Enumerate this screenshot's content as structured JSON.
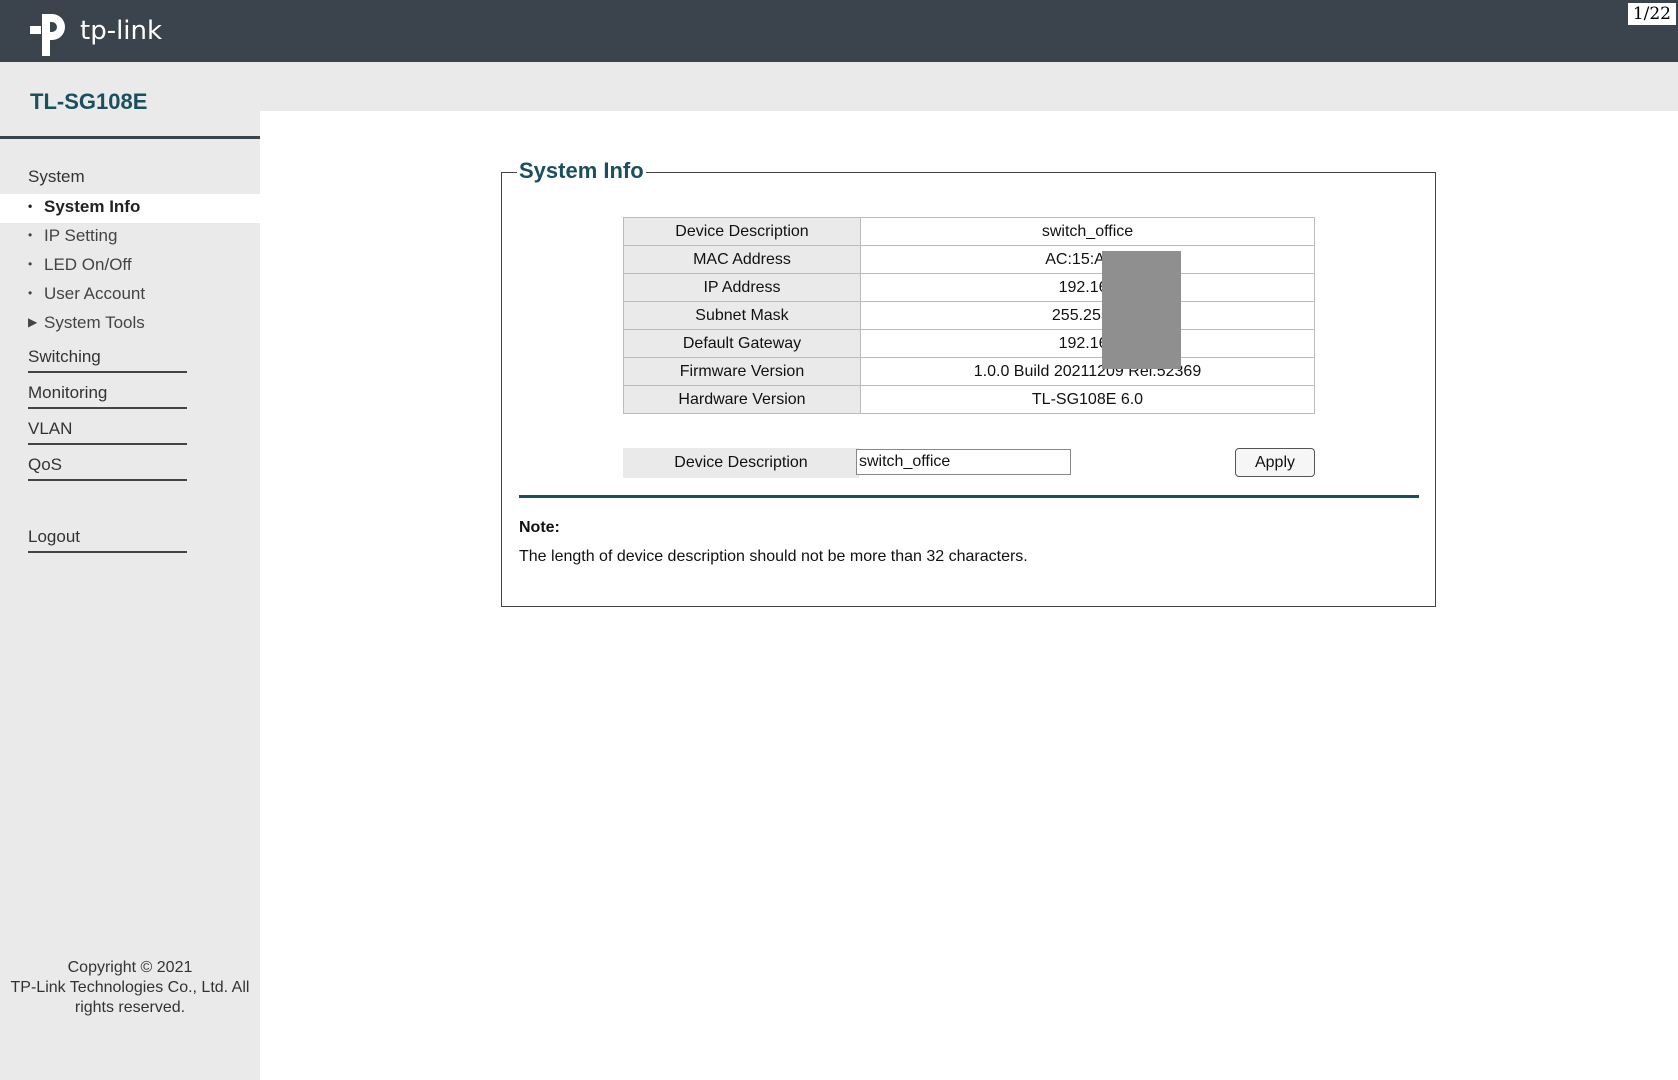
{
  "header": {
    "logo_text": "tp-link",
    "page_counter": "1/22"
  },
  "model": "TL-SG108E",
  "sidebar": {
    "section_system": "System",
    "system_items": [
      {
        "label": "System Info",
        "active": true
      },
      {
        "label": "IP Setting"
      },
      {
        "label": "LED On/Off"
      },
      {
        "label": "User Account"
      },
      {
        "label": "System Tools",
        "expandable": true
      }
    ],
    "groups": [
      "Switching",
      "Monitoring",
      "VLAN",
      "QoS"
    ],
    "logout": "Logout",
    "copyright_lines": [
      "Copyright © 2021",
      "TP-Link Technologies Co., Ltd. All",
      "rights reserved."
    ]
  },
  "panel": {
    "title": "System Info",
    "rows": [
      {
        "key": "Device Description",
        "value": "switch_office"
      },
      {
        "key": "MAC Address",
        "value": "AC:15:A2:C"
      },
      {
        "key": "IP Address",
        "value": "192.168"
      },
      {
        "key": "Subnet Mask",
        "value": "255.255.2"
      },
      {
        "key": "Default Gateway",
        "value": "192.168"
      },
      {
        "key": "Firmware Version",
        "value": "1.0.0 Build 20211209 Rel.52369"
      },
      {
        "key": "Hardware Version",
        "value": "TL-SG108E 6.0"
      }
    ],
    "form": {
      "label": "Device Description",
      "input_value": "switch_office",
      "apply_label": "Apply"
    },
    "note_title": "Note:",
    "note_text": "The length of device description should not be more than 32 characters."
  },
  "colors": {
    "header_bg": "#3b444c",
    "accent": "#1b4f5e",
    "sidebar_bg": "#eaeaea"
  }
}
